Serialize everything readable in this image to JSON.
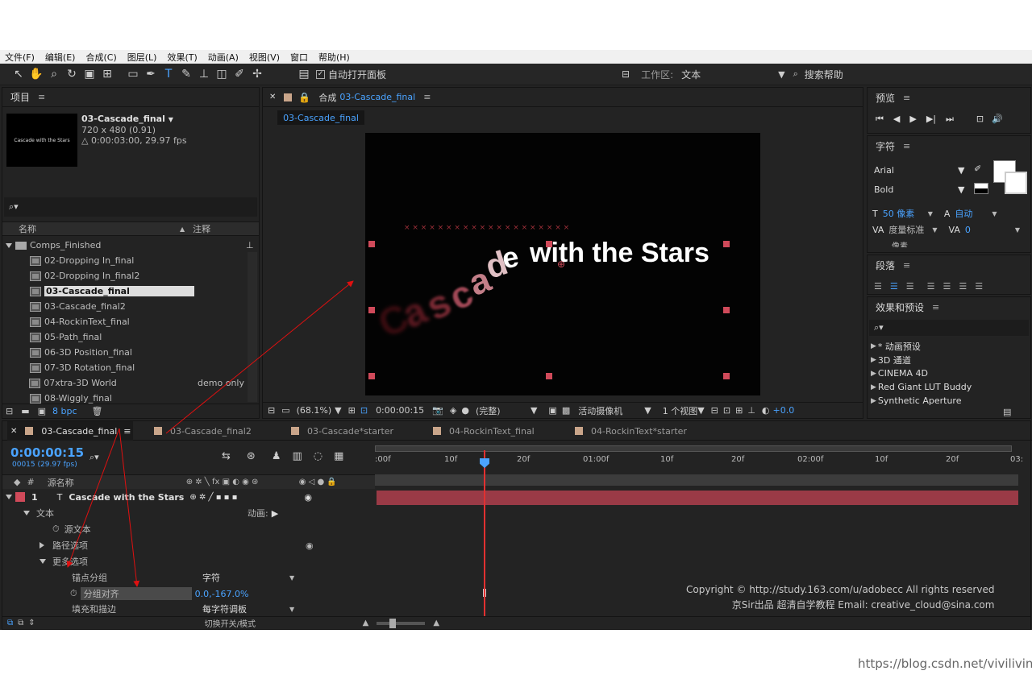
{
  "menu": [
    "文件(F)",
    "编辑(E)",
    "合成(C)",
    "图层(L)",
    "效果(T)",
    "动画(A)",
    "视图(V)",
    "窗口",
    "帮助(H)"
  ],
  "toolbar": {
    "auto_open": "自动打开面板",
    "workspace_label": "工作区:",
    "workspace_value": "文本",
    "search_help": "搜索帮助"
  },
  "project": {
    "title": "项目",
    "comp_name": "03-Cascade_final",
    "comp_size": "720 x 480 (0.91)",
    "comp_duration": "△ 0:00:03:00, 29.97 fps",
    "thumb_text": "Cascade with the Stars",
    "col_name": "名称",
    "col_comment": "注释",
    "folder": "Comps_Finished",
    "items": [
      {
        "name": "02-Dropping In_final",
        "note": ""
      },
      {
        "name": "02-Dropping In_final2",
        "note": ""
      },
      {
        "name": "03-Cascade_final",
        "note": ""
      },
      {
        "name": "03-Cascade_final2",
        "note": ""
      },
      {
        "name": "04-RockinText_final",
        "note": ""
      },
      {
        "name": "05-Path_final",
        "note": ""
      },
      {
        "name": "06-3D Position_final",
        "note": ""
      },
      {
        "name": "07-3D Rotation_final",
        "note": ""
      },
      {
        "name": "07xtra-3D World",
        "note": "demo only"
      },
      {
        "name": "08-Wiggly_final",
        "note": ""
      }
    ],
    "bpc": "8 bpc"
  },
  "viewer": {
    "title": "合成",
    "comp_link": "03-Cascade_final",
    "tab": "03-Cascade_final",
    "text_main": "with the Stars",
    "letters": [
      "C",
      "a",
      "s",
      "c",
      "a",
      "d",
      "e"
    ],
    "zoom": "(68.1%)",
    "timecode": "0:00:00:15",
    "quality": "(完整)",
    "camera": "活动摄像机",
    "views": "1 个视图",
    "offset": "+0.0"
  },
  "preview": {
    "title": "预览"
  },
  "character": {
    "title": "字符",
    "font": "Arial",
    "style": "Bold",
    "size": "50 像素",
    "size_auto": "自动",
    "metric": "度量标准",
    "tracking": "0",
    "cut": "像素"
  },
  "paragraph": {
    "title": "段落"
  },
  "effects": {
    "title": "效果和预设",
    "items": [
      "* 动画预设",
      "3D 通道",
      "CINEMA 4D",
      "Red Giant LUT Buddy",
      "Synthetic Aperture"
    ]
  },
  "timeline": {
    "tabs": [
      "03-Cascade_final",
      "03-Cascade_final2",
      "03-Cascade*starter",
      "04-RockinText_final",
      "04-RockinText*starter"
    ],
    "timecode": "0:00:00:15",
    "frames": "00015 (29.97 fps)",
    "col_source": "源名称",
    "ruler": [
      ":00f",
      "10f",
      "20f",
      "01:00f",
      "10f",
      "20f",
      "02:00f",
      "10f",
      "20f",
      "03:"
    ],
    "layer_num": "1",
    "layer_name": "Cascade with the Stars",
    "text_group": "文本",
    "animate": "动画:",
    "source_text": "源文本",
    "path_options": "路径选项",
    "more_options": "更多选项",
    "anchor_group": "锚点分组",
    "anchor_value": "字符",
    "group_align": "分组对齐",
    "group_align_value": "0.0,-167.0%",
    "fill_stroke": "填充和描边",
    "fill_value": "每字符调板",
    "switch_mode": "切换开关/模式"
  },
  "watermark": {
    "line1": "Copyright © http://study.163.com/u/adobecc All rights reserved",
    "line2": "京Sir出品  超清自学教程 Email: creative_cloud@sina.com"
  },
  "blog": "https://blog.csdn.net/viviliving"
}
